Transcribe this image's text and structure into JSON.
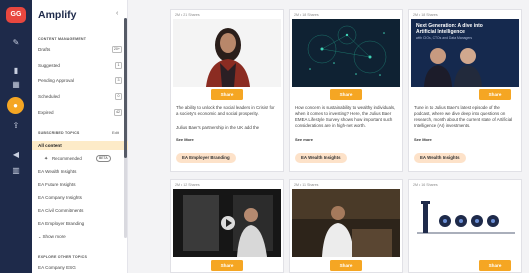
{
  "app": {
    "logo": "GG",
    "title": "Amplify",
    "collapse_icon": "chevron-left-icon"
  },
  "rail": {
    "icons": [
      "edit-icon",
      "chart-icon",
      "grid-icon",
      "people-icon",
      "share-icon",
      "megaphone-icon",
      "bar-chart-icon"
    ]
  },
  "sidebar": {
    "content_management_heading": "CONTENT MANAGEMENT",
    "content_items": [
      {
        "label": "Drafts",
        "count": "20+"
      },
      {
        "label": "Suggested",
        "count": "1"
      },
      {
        "label": "Pending Approval",
        "count": "3"
      },
      {
        "label": "Scheduled",
        "count": "0"
      },
      {
        "label": "Expired",
        "count": "42"
      }
    ],
    "subscribed_heading": "SUBSCRIBED TOPICS",
    "edit_label": "Edit",
    "all_content": "All content",
    "recommended": {
      "label": "Recommended",
      "badge": "BETA"
    },
    "topics": [
      "EA Wealth Insights",
      "EA Future Insights",
      "EA Company Insights",
      "EA Civil Commitments",
      "EA Employer Branding"
    ],
    "show_more": "Show more",
    "explore_heading": "EXPLORE OTHER TOPICS",
    "explore_first": "EA Company ESG"
  },
  "cards": [
    {
      "meta": "2M  •  21 Shares",
      "share_label": "Share",
      "text": "The ability to unlock the social leaders in Crisis! for a society's economic and social prosperity.",
      "text2": "Julius Baer's partnership in the UK add the",
      "see_more": "See More",
      "tag": "EA Employer Branding"
    },
    {
      "meta": "2M  •  18 Shares",
      "share_label": "Share",
      "text": "How concern is sustainability to wealthy individuals, when it comes to investing? Here, the Julius Baer EMEA Lifestyle Survey shows how important such considerations are in high-net worth.",
      "see_more": "See more",
      "tag": "EA Wealth Insights"
    },
    {
      "meta": "2M  •  18 Shares",
      "share_label": "Share",
      "slide_title": "Next Generation: A dive into Artificial Intelligence",
      "slide_subtitle": "with CIOs, CTOs and Data Managers",
      "text": "Tune in to Julius Baer's latest episode of the podcast, where we dive deep into questions on research, month about the current state of Artificial Intelligence (AI) investments.",
      "see_more": "See More",
      "tag": "EA Wealth Insights"
    },
    {
      "meta": "2M  •  12 Shares",
      "share_label": "Share"
    },
    {
      "meta": "2M  •  11 Shares",
      "share_label": "Share"
    },
    {
      "meta": "2M  •  16 Shares",
      "share_label": "Share"
    }
  ],
  "colors": {
    "accent": "#f5a623",
    "rail": "#1e2a4a",
    "active_row": "#fdebc8",
    "logo": "#e8473f"
  }
}
